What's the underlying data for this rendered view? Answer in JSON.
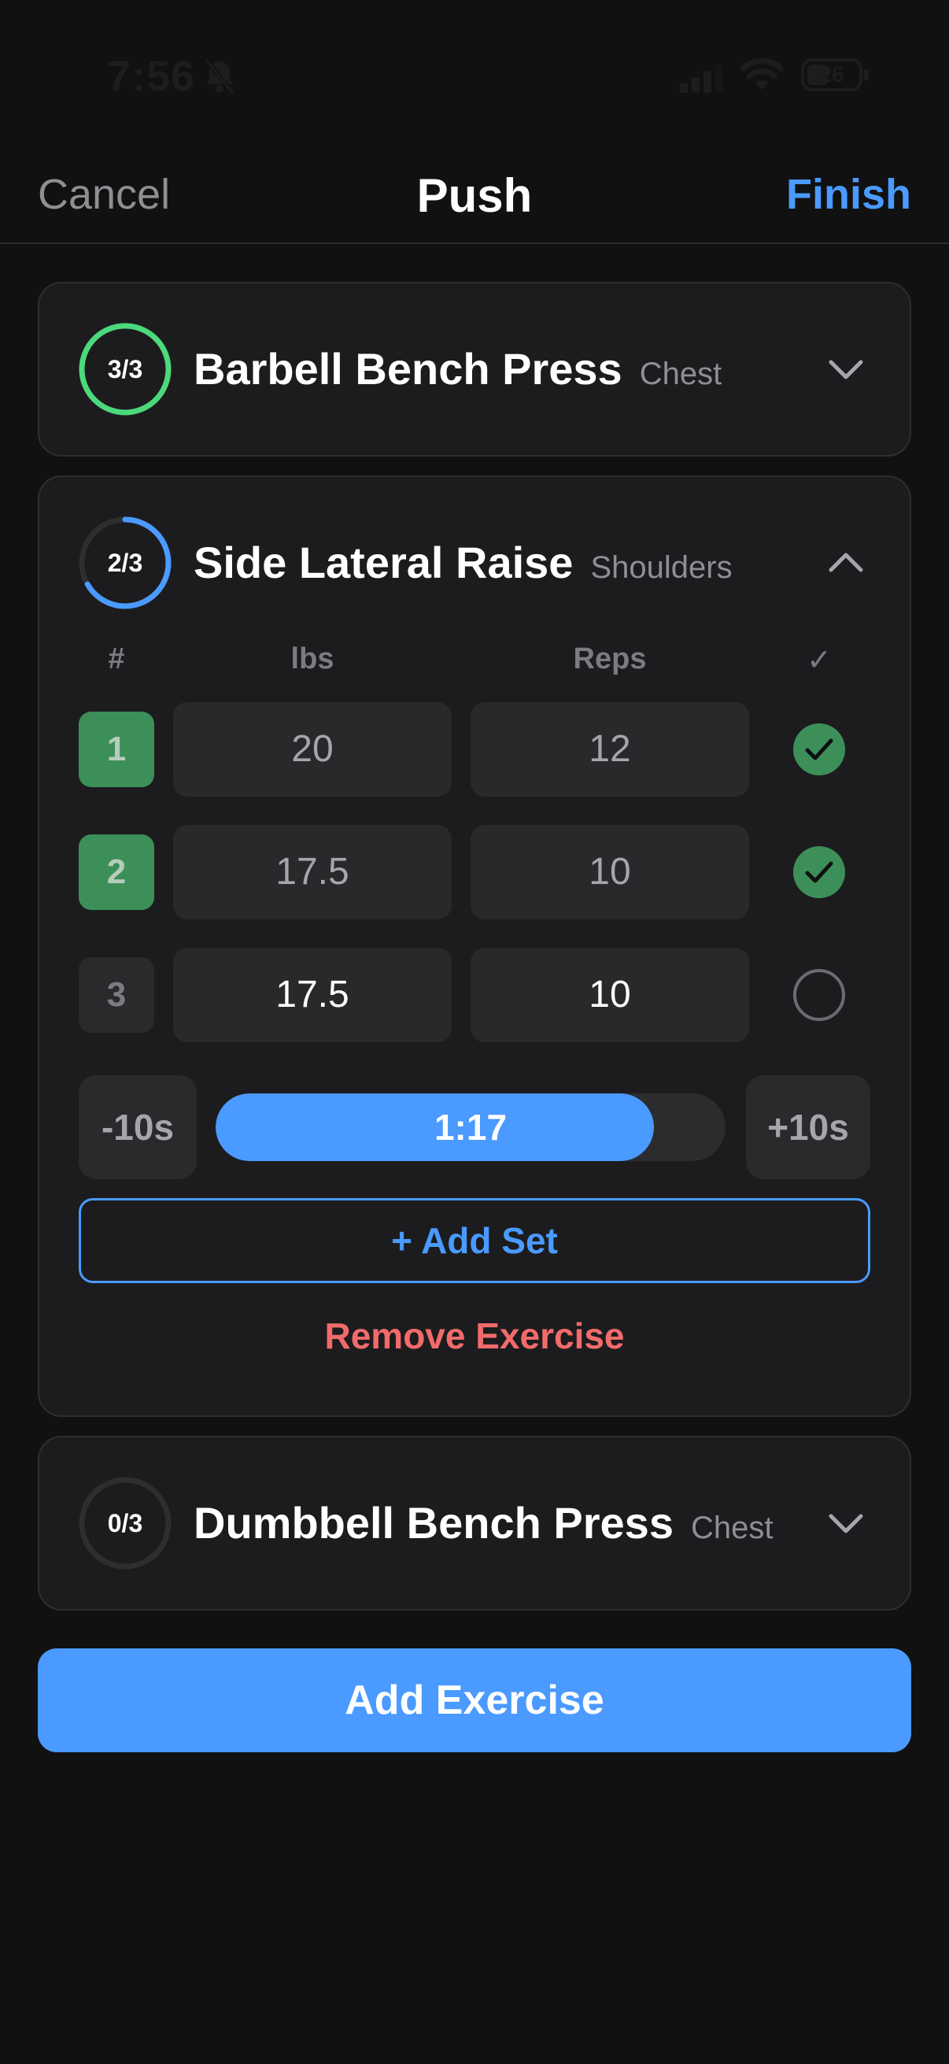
{
  "status": {
    "time": "7:56",
    "battery": "26"
  },
  "nav": {
    "cancel": "Cancel",
    "title": "Push",
    "finish": "Finish"
  },
  "exercises": [
    {
      "name": "Barbell Bench Press",
      "muscle": "Chest",
      "progress": "3/3",
      "completed_fraction": 1.0,
      "expanded": false
    },
    {
      "name": "Side Lateral Raise",
      "muscle": "Shoulders",
      "progress": "2/3",
      "completed_fraction": 0.667,
      "expanded": true
    },
    {
      "name": "Dumbbell Bench Press",
      "muscle": "Chest",
      "progress": "0/3",
      "completed_fraction": 0.0,
      "expanded": false
    }
  ],
  "set_table": {
    "headers": {
      "num": "#",
      "weight": "lbs",
      "reps": "Reps",
      "done": "✓"
    },
    "sets": [
      {
        "num": "1",
        "weight": "20",
        "reps": "12",
        "completed": true
      },
      {
        "num": "2",
        "weight": "17.5",
        "reps": "10",
        "completed": true
      },
      {
        "num": "3",
        "weight": "17.5",
        "reps": "10",
        "completed": false
      }
    ]
  },
  "rest_timer": {
    "minus": "-10s",
    "plus": "+10s",
    "remaining": "1:17",
    "fill_fraction": 0.86
  },
  "actions": {
    "add_set": "+ Add Set",
    "remove_exercise": "Remove Exercise",
    "add_exercise": "Add Exercise"
  },
  "colors": {
    "accent": "#4a9aff",
    "success": "#3c8f59",
    "ring_complete": "#4cd97b",
    "danger": "#f26b6b"
  }
}
